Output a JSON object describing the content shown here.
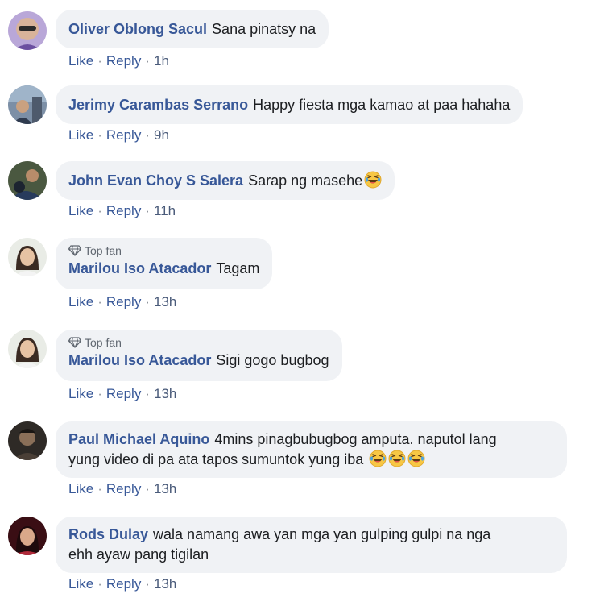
{
  "colors": {
    "author": "#385898",
    "bubble_bg": "#f0f2f5",
    "action": "#385898",
    "text": "#1c1e21",
    "badge": "#606770"
  },
  "comments": [
    {
      "author": "Oliver Oblong Sacul",
      "text": "Sana pinatsy na",
      "like": "Like",
      "reply": "Reply",
      "sep": "·",
      "time": "1h"
    },
    {
      "author": "Jerimy Carambas Serrano",
      "text": "Happy fiesta mga kamao at paa hahaha",
      "like": "Like",
      "reply": "Reply",
      "sep": "·",
      "time": "9h"
    },
    {
      "author": "John Evan Choy S Salera",
      "text": "Sarap ng masehe",
      "emoji": "laughing-tears-emoji",
      "like": "Like",
      "reply": "Reply",
      "sep": "·",
      "time": "11h"
    },
    {
      "badge": "Top fan",
      "badge_icon": "diamond-icon",
      "author": "Marilou Iso Atacador",
      "text": "Tagam",
      "like": "Like",
      "reply": "Reply",
      "sep": "·",
      "time": "13h"
    },
    {
      "badge": "Top fan",
      "badge_icon": "diamond-icon",
      "author": "Marilou Iso Atacador",
      "text": "Sigi gogo bugbog",
      "like": "Like",
      "reply": "Reply",
      "sep": "·",
      "time": "13h"
    },
    {
      "author": "Paul Michael Aquino",
      "text_line1": "4mins pinagbubugbog amputa. naputol lang",
      "text_line2": "yung video di pa ata tapos sumuntok yung iba",
      "emoji": "laughing-tears-emoji",
      "like": "Like",
      "reply": "Reply",
      "sep": "·",
      "time": "13h"
    },
    {
      "author": "Rods Dulay",
      "text_line1": "wala namang awa yan mga yan gulping gulpi na nga",
      "text_line2": "ehh ayaw pang tigilan",
      "like": "Like",
      "reply": "Reply",
      "sep": "·",
      "time": "13h"
    }
  ]
}
